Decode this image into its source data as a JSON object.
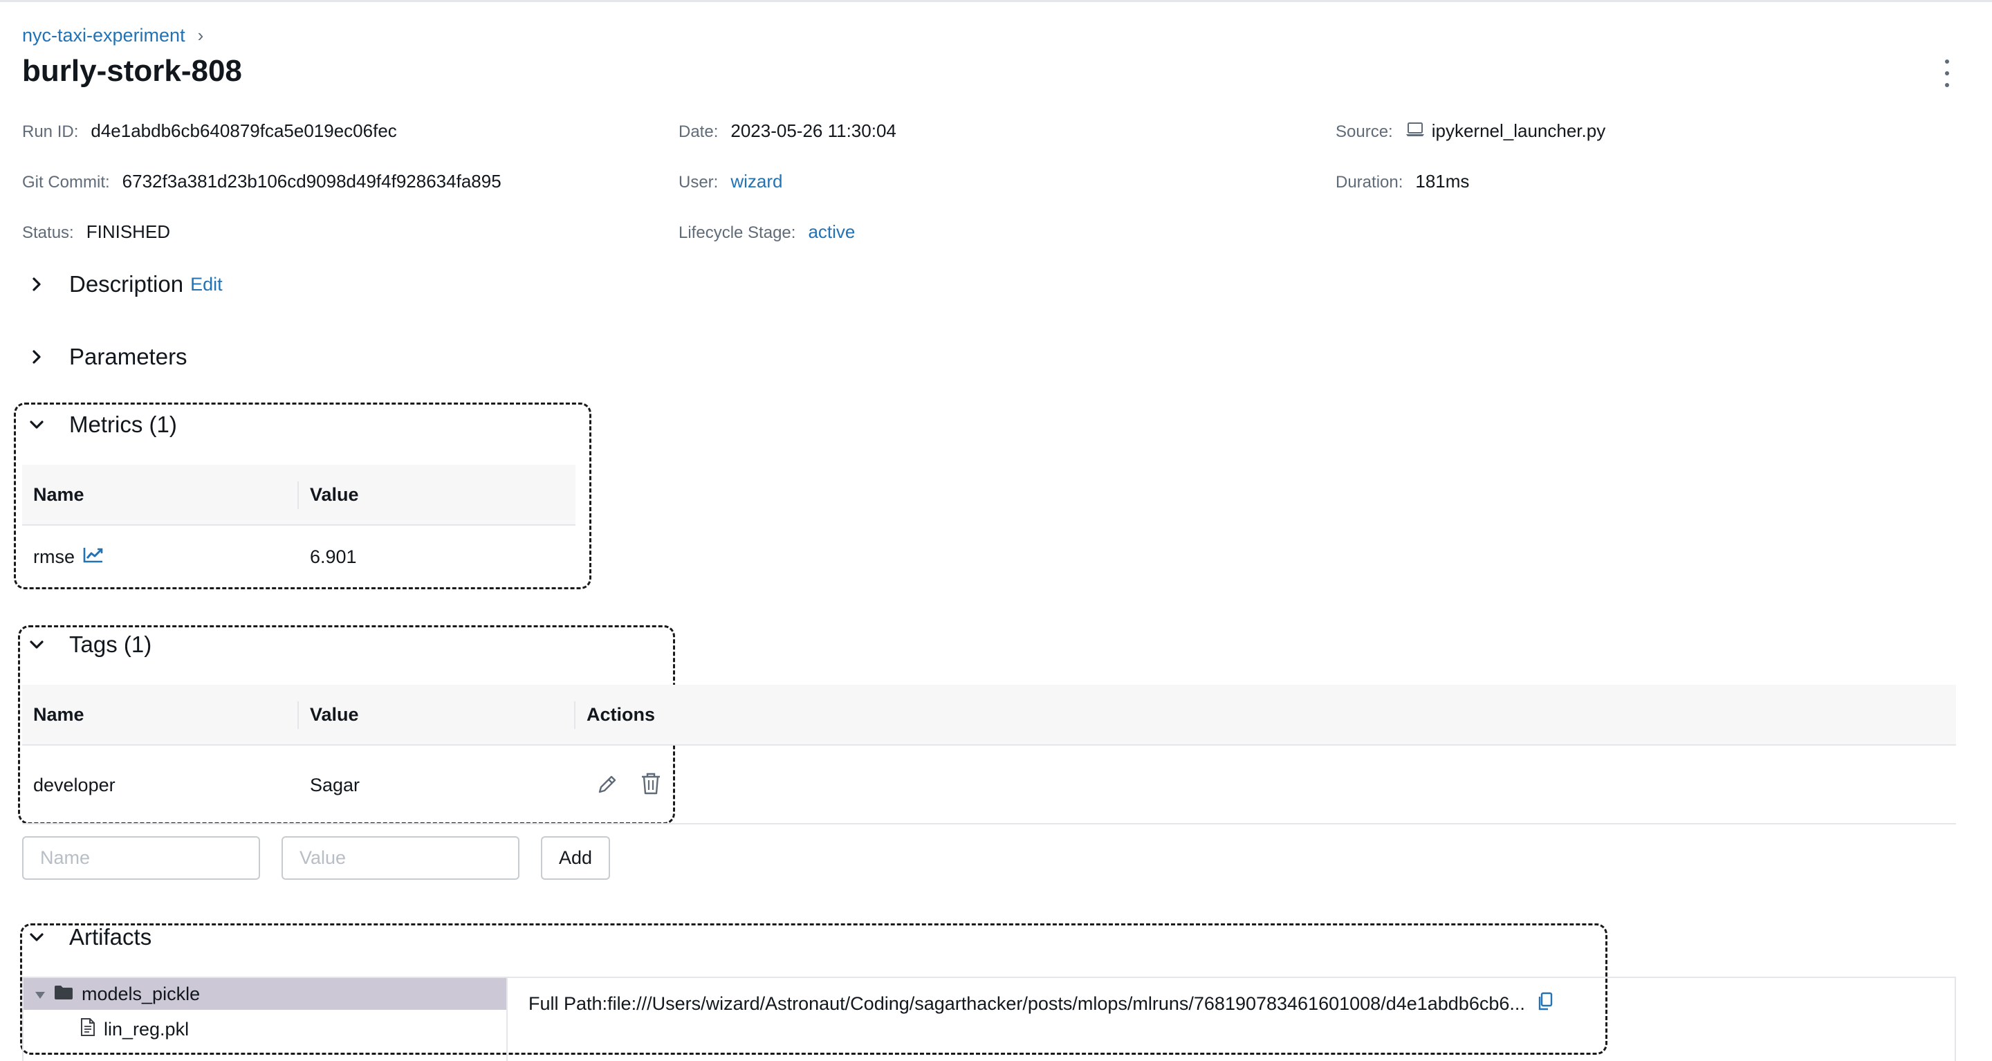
{
  "breadcrumb": {
    "experiment": "nyc-taxi-experiment",
    "separator": "›"
  },
  "run": {
    "title": "burly-stork-808"
  },
  "metadata": {
    "run_id": {
      "label": "Run ID:",
      "value": "d4e1abdb6cb640879fca5e019ec06fec"
    },
    "date": {
      "label": "Date:",
      "value": "2023-05-26 11:30:04"
    },
    "source": {
      "label": "Source:",
      "value": "ipykernel_launcher.py",
      "icon": "laptop-icon"
    },
    "git_commit": {
      "label": "Git Commit:",
      "value": "6732f3a381d23b106cd9098d49f4f928634fa895"
    },
    "user": {
      "label": "User:",
      "value": "wizard"
    },
    "duration": {
      "label": "Duration:",
      "value": "181ms"
    },
    "status": {
      "label": "Status:",
      "value": "FINISHED"
    },
    "lifecycle": {
      "label": "Lifecycle Stage:",
      "value": "active"
    }
  },
  "sections": {
    "description": {
      "label": "Description",
      "edit": "Edit"
    },
    "parameters": {
      "label": "Parameters"
    },
    "metrics": {
      "label": "Metrics (1)",
      "columns": [
        "Name",
        "Value"
      ],
      "rows": [
        {
          "name": "rmse",
          "value": "6.901",
          "icon": "chart-line-icon"
        }
      ]
    },
    "tags": {
      "label": "Tags (1)",
      "columns": [
        "Name",
        "Value",
        "Actions"
      ],
      "rows": [
        {
          "name": "developer",
          "value": "Sagar"
        }
      ],
      "name_placeholder": "Name",
      "value_placeholder": "Value",
      "add_label": "Add"
    },
    "artifacts": {
      "label": "Artifacts",
      "tree": [
        {
          "name": "models_pickle",
          "type": "folder",
          "expanded": true,
          "selected": true
        },
        {
          "name": "lin_reg.pkl",
          "type": "file"
        }
      ],
      "full_path_label": "Full Path:",
      "full_path": "file:///Users/wizard/Astronaut/Coding/sagarthacker/posts/mlops/mlruns/768190783461601008/d4e1abdb6cb6..."
    }
  },
  "colors": {
    "link": "#2272b4",
    "header_bg": "#f7f7f7",
    "selected_bg": "#cdc8d6"
  }
}
